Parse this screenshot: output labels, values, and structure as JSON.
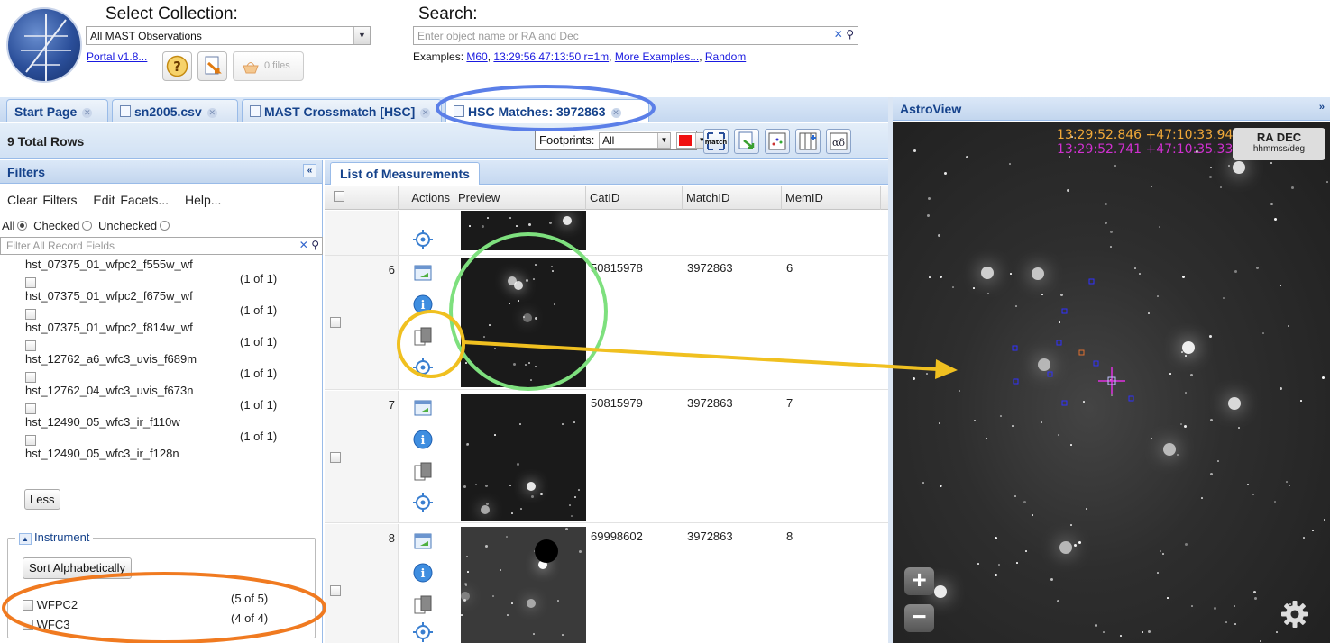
{
  "header": {
    "collection_label": "Select Collection:",
    "collection_value": "All MAST Observations",
    "portal_link": "Portal v1.8...",
    "files_button": "0 files",
    "search_label": "Search:",
    "search_placeholder": "Enter object name or RA and Dec",
    "examples_prefix": "Examples:",
    "examples": [
      "M60",
      "13:29:56 47:13:50 r=1m",
      "More Examples...",
      "Random"
    ]
  },
  "tabs": [
    {
      "label": "Start Page"
    },
    {
      "label": "sn2005.csv"
    },
    {
      "label": "MAST Crossmatch [HSC]"
    },
    {
      "label": "HSC Matches: 3972863"
    }
  ],
  "toolbar": {
    "total_rows": "9 Total Rows",
    "footprints_label": "Footprints:",
    "footprints_value": "All",
    "footprint_color": "#f01010",
    "match_label": "match"
  },
  "filters": {
    "title": "Filters",
    "links": [
      "Clear Filters",
      "Edit Facets...",
      "Help..."
    ],
    "radio_all": "All",
    "radio_checked": "Checked",
    "radio_unchecked": "Unchecked",
    "field_placeholder": "Filter All Record Fields",
    "facets": [
      {
        "name": "hst_07375_01_wfpc2_f555w_wf",
        "count": "(1 of 1)"
      },
      {
        "name": "hst_07375_01_wfpc2_f675w_wf",
        "count": "(1 of 1)"
      },
      {
        "name": "hst_07375_01_wfpc2_f814w_wf",
        "count": "(1 of 1)"
      },
      {
        "name": "hst_12762_a6_wfc3_uvis_f689m",
        "count": "(1 of 1)"
      },
      {
        "name": "hst_12762_04_wfc3_uvis_f673n",
        "count": "(1 of 1)"
      },
      {
        "name": "hst_12490_05_wfc3_ir_f110w",
        "count": "(1 of 1)"
      },
      {
        "name": "hst_12490_05_wfc3_ir_f128n",
        "count": ""
      }
    ],
    "less_button": "Less",
    "instrument_title": "Instrument",
    "sort_button": "Sort Alphabetically",
    "instruments": [
      {
        "name": "WFPC2",
        "count": "(5 of 5)"
      },
      {
        "name": "WFC3",
        "count": "(4 of 4)"
      }
    ]
  },
  "grid": {
    "tab": "List of Measurements",
    "columns": [
      "Actions",
      "Preview",
      "CatID",
      "MatchID",
      "MemID"
    ],
    "rows": [
      {
        "num": "6",
        "catid": "50815978",
        "matchid": "3972863",
        "memid": "6"
      },
      {
        "num": "7",
        "catid": "50815979",
        "matchid": "3972863",
        "memid": "7"
      },
      {
        "num": "8",
        "catid": "69998602",
        "matchid": "3972863",
        "memid": "8"
      }
    ]
  },
  "astroview": {
    "title": "AstroView",
    "coord_primary": "13:29:52.846 +47:10:33.94",
    "coord_secondary": "13:29:52.741 +47:10:35.33",
    "radec_label": "RA DEC",
    "radec_units": "hhmmss/deg",
    "zoom_in": "+",
    "zoom_out": "−"
  },
  "colors": {
    "highlight_tab": "#5b7fe8",
    "highlight_preview": "#7ee07e",
    "highlight_action": "#f0c020",
    "highlight_instrument": "#f07a20",
    "arrow": "#f0c020"
  }
}
